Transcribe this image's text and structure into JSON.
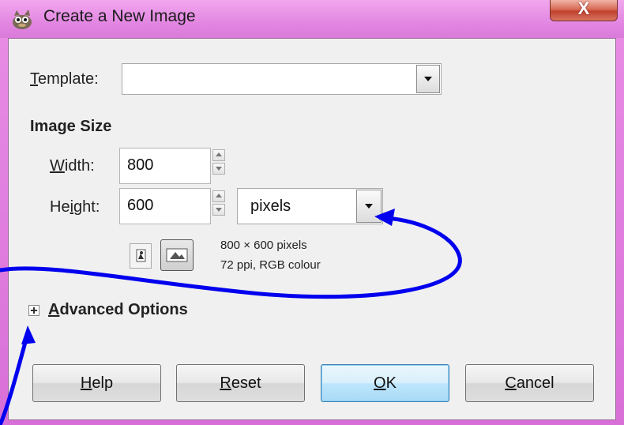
{
  "window": {
    "title": "Create a New Image",
    "close_symbol": "X"
  },
  "template": {
    "label_mnemonic": "T",
    "label_rest": "emplate:",
    "value": ""
  },
  "image_size": {
    "section_title": "Image Size",
    "width_mnemonic": "W",
    "width_rest": "idth:",
    "width_value": "800",
    "height_pre": "He",
    "height_mnemonic": "i",
    "height_rest": "ght:",
    "height_value": "600",
    "units_value": "pixels"
  },
  "info": {
    "line1": "800 × 600 pixels",
    "line2": "72 ppi, RGB colour"
  },
  "advanced": {
    "label_mnemonic": "A",
    "label_rest": "dvanced Options"
  },
  "buttons": {
    "help_mnemonic": "H",
    "help_rest": "elp",
    "reset_mnemonic": "R",
    "reset_rest": "eset",
    "ok_mnemonic": "O",
    "ok_rest": "K",
    "cancel_mnemonic": "C",
    "cancel_rest": "ancel"
  },
  "colors": {
    "title_bar": "#e287e2",
    "annotation_arrow": "#0000ee",
    "default_button": "#bee6fd"
  },
  "icons": {
    "app": "gimp-wilber-icon",
    "close": "close-icon",
    "portrait": "portrait-icon",
    "landscape": "landscape-icon",
    "expander": "expander-plus-icon"
  }
}
